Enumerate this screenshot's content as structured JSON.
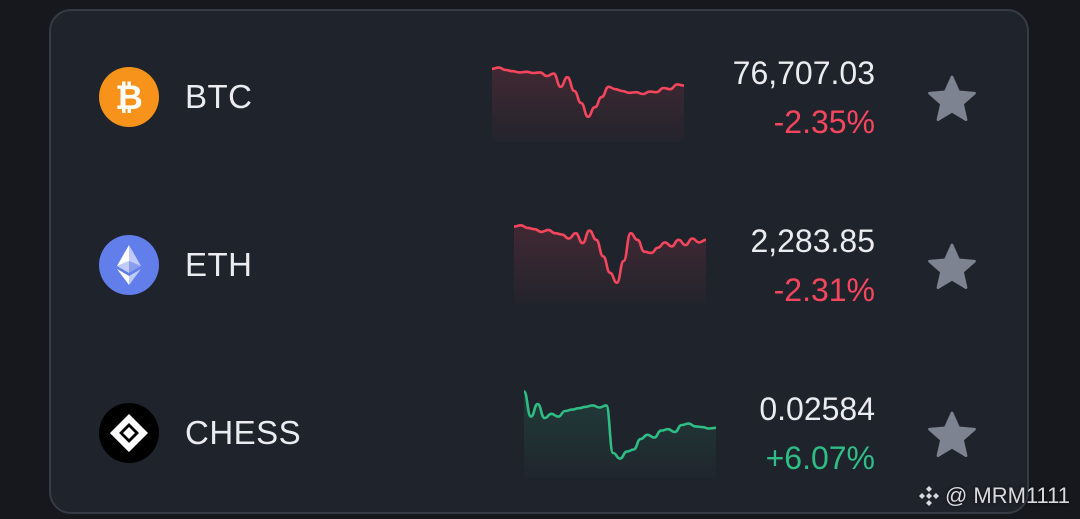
{
  "colors": {
    "negative": "#f6465d",
    "positive": "#2ebd85",
    "star": "#7d8390",
    "btc": "#f7931a",
    "eth": "#627eea",
    "chess": "#000000"
  },
  "coins": [
    {
      "ticker": "BTC",
      "price": "76,707.03",
      "change": "-2.35%",
      "trend": "negative",
      "icon": "bitcoin-icon",
      "sparkline": [
        0.92,
        0.94,
        0.9,
        0.88,
        0.86,
        0.87,
        0.85,
        0.86,
        0.8,
        0.84,
        0.62,
        0.78,
        0.55,
        0.35,
        0.12,
        0.28,
        0.45,
        0.62,
        0.58,
        0.55,
        0.52,
        0.53,
        0.5,
        0.54,
        0.53,
        0.6,
        0.58,
        0.66,
        0.64
      ]
    },
    {
      "ticker": "ETH",
      "price": "2,283.85",
      "change": "-2.31%",
      "trend": "negative",
      "icon": "ethereum-icon",
      "sparkline": [
        0.9,
        0.92,
        0.88,
        0.86,
        0.82,
        0.85,
        0.8,
        0.78,
        0.72,
        0.8,
        0.65,
        0.84,
        0.7,
        0.45,
        0.2,
        0.05,
        0.38,
        0.8,
        0.7,
        0.52,
        0.5,
        0.58,
        0.66,
        0.6,
        0.7,
        0.62,
        0.72,
        0.66,
        0.7
      ]
    },
    {
      "ticker": "CHESS",
      "price": "0.02584",
      "change": "+6.07%",
      "trend": "positive",
      "icon": "chess-icon",
      "sparkline": [
        0.98,
        0.62,
        0.8,
        0.6,
        0.66,
        0.62,
        0.7,
        0.72,
        0.74,
        0.76,
        0.78,
        0.75,
        0.78,
        0.1,
        0.02,
        0.12,
        0.15,
        0.3,
        0.36,
        0.32,
        0.42,
        0.44,
        0.4,
        0.5,
        0.52,
        0.48,
        0.47,
        0.45,
        0.46
      ]
    }
  ],
  "watermark": {
    "text": "@ MRM1111",
    "icon": "binance-logo-icon"
  }
}
